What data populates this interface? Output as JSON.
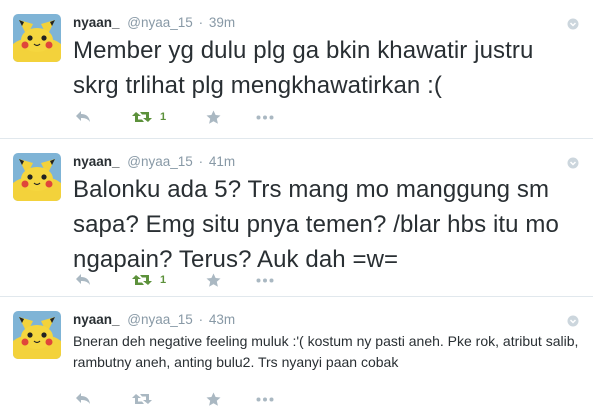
{
  "colors": {
    "icon_gray": "#aab8c2",
    "retweeted_green": "#5c913b",
    "name_text": "#292f33",
    "meta_text": "#8899a6",
    "divider": "#e1e8ed"
  },
  "tweets": [
    {
      "fullname": "nyaan_",
      "screenname": "@nyaa_15",
      "separator": "·",
      "time": "39m",
      "text": "Member yg dulu plg ga bkin khawatir justru skrg trlihat plg mengkhawatirkan :(",
      "retweet_count": "1",
      "icons": [
        "reply-icon",
        "retweet-icon",
        "favorite-icon",
        "more-icon"
      ]
    },
    {
      "fullname": "nyaan_",
      "screenname": "@nyaa_15",
      "separator": "·",
      "time": "41m",
      "text": "Balonku ada 5? Trs mang mo manggung sm sapa? Emg situ pnya temen? /blar hbs itu mo ngapain? Terus? Auk dah =w=",
      "retweet_count": "1",
      "icons": [
        "reply-icon",
        "retweet-icon",
        "favorite-icon",
        "more-icon"
      ]
    },
    {
      "fullname": "nyaan_",
      "screenname": "@nyaa_15",
      "separator": "·",
      "time": "43m",
      "text": "Bneran deh negative feeling muluk :'( kostum ny pasti aneh. Pke rok, atribut salib, rambutny aneh, anting bulu2. Trs nyanyi paan cobak",
      "retweet_count": "",
      "icons": [
        "reply-icon",
        "retweet-icon",
        "favorite-icon",
        "more-icon"
      ]
    }
  ]
}
